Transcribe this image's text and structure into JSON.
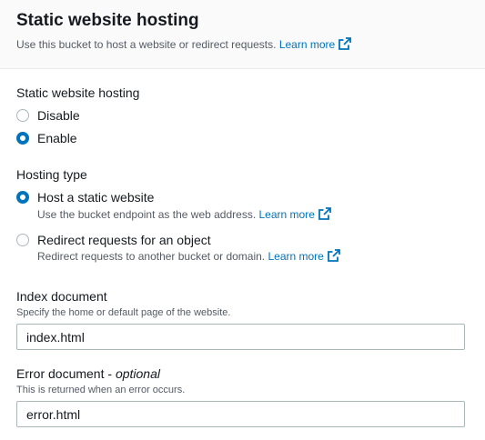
{
  "header": {
    "title": "Static website hosting",
    "description": "Use this bucket to host a website or redirect requests.",
    "learn_more": "Learn more"
  },
  "hosting": {
    "label": "Static website hosting",
    "options": [
      {
        "label": "Disable",
        "checked": false
      },
      {
        "label": "Enable",
        "checked": true
      }
    ]
  },
  "hosting_type": {
    "label": "Hosting type",
    "options": [
      {
        "label": "Host a static website",
        "description": "Use the bucket endpoint as the web address.",
        "learn_more": "Learn more",
        "checked": true
      },
      {
        "label": "Redirect requests for an object",
        "description": "Redirect requests to another bucket or domain.",
        "learn_more": "Learn more",
        "checked": false
      }
    ]
  },
  "index_document": {
    "label": "Index document",
    "description": "Specify the home or default page of the website.",
    "value": "index.html"
  },
  "error_document": {
    "label": "Error document",
    "optional": "optional",
    "description": "This is returned when an error occurs.",
    "value": "error.html"
  },
  "colors": {
    "accent": "#0073bb",
    "text": "#16191f",
    "secondary_text": "#545b64",
    "border": "#aab7b8"
  },
  "icons": {
    "external_link": "external-link-icon"
  }
}
